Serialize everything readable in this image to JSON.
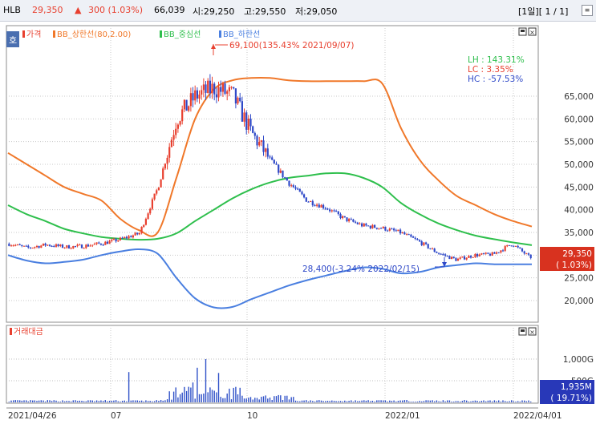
{
  "header": {
    "ticker": "HLB",
    "price": "29,350",
    "change_arrow": "▲",
    "change": "300 (1.03%)",
    "volume": "66,039",
    "open": "시:29,250",
    "high": "고:29,550",
    "low": "저:29,050",
    "period": "[1일][ 1 / 1]"
  },
  "colors": {
    "price_up": "#e8402f",
    "price_down": "#2f49c8",
    "bb_upper": "#f0782a",
    "bb_middle": "#2ebf4c",
    "bb_lower": "#4a7fe0",
    "volume": "#3052c8"
  },
  "price_panel": {
    "tab_label": "호",
    "legend": [
      {
        "label": "가격",
        "color": "#e8402f"
      },
      {
        "label": "BB_상한선(80,2.00)",
        "color": "#f0782a"
      },
      {
        "label": "BB_중심선",
        "color": "#2ebf4c"
      },
      {
        "label": "BB_하한선",
        "color": "#4a7fe0"
      }
    ],
    "high_annotation": "69,100(135.43% 2021/09/07)",
    "low_annotation": "28,400(-3.24% 2022/02/15)",
    "stats": {
      "lh": "LH :  143.31%",
      "lc": "LC :    3.35%",
      "hc": "HC :  -57.53%"
    },
    "current_price_box": "29,350",
    "current_change_box": "( 1.03%)",
    "y_ticks": [
      "65,000",
      "60,000",
      "55,000",
      "50,000",
      "45,000",
      "40,000",
      "35,000",
      "30,000",
      "25,000",
      "20,000"
    ]
  },
  "volume_panel": {
    "legend": "거래대금",
    "y_ticks": [
      "1,000G",
      "500G"
    ],
    "current_value_box": "1,935M",
    "current_pct_box": "( 19.71%)"
  },
  "x_axis": {
    "labels": [
      "2021/04/26",
      "07",
      "10",
      "2022/01",
      "2022/04/01"
    ]
  },
  "chart_data": {
    "type": "line",
    "title": "",
    "ylabel": "",
    "xlabel": "",
    "ylim": [
      15000,
      71000
    ],
    "x": [
      "2021/04/26",
      "2021/05/10",
      "2021/05/24",
      "2021/06/07",
      "2021/06/21",
      "2021/07/05",
      "2021/07/19",
      "2021/08/02",
      "2021/08/09",
      "2021/08/16",
      "2021/08/23",
      "2021/08/30",
      "2021/09/07",
      "2021/09/13",
      "2021/09/27",
      "2021/10/11",
      "2021/10/25",
      "2021/11/08",
      "2021/11/22",
      "2021/12/06",
      "2021/12/20",
      "2022/01/03",
      "2022/01/17",
      "2022/01/31",
      "2022/02/15",
      "2022/02/28",
      "2022/03/14",
      "2022/03/28",
      "2022/04/01"
    ],
    "series": [
      {
        "name": "가격",
        "values": [
          32500,
          31600,
          32300,
          31800,
          32000,
          32600,
          33500,
          34800,
          45000,
          60000,
          65000,
          66800,
          65200,
          57000,
          51000,
          46000,
          42000,
          40500,
          38000,
          36500,
          36000,
          35000,
          33000,
          30500,
          29000,
          30000,
          30200,
          32500,
          29350
        ]
      },
      {
        "name": "BB_상한선(80,2.00)",
        "values": [
          52500,
          50000,
          47500,
          45000,
          43500,
          42000,
          38000,
          35500,
          35000,
          47000,
          60000,
          66500,
          68500,
          69000,
          69000,
          68500,
          68300,
          68300,
          68300,
          68300,
          67800,
          58000,
          51000,
          46500,
          43000,
          41000,
          39000,
          37500,
          36300
        ]
      },
      {
        "name": "BB_중심선",
        "values": [
          41000,
          39000,
          37500,
          35800,
          34800,
          34000,
          33600,
          33400,
          33600,
          34800,
          37500,
          40000,
          42500,
          44500,
          46000,
          47000,
          47500,
          48000,
          48000,
          47000,
          45000,
          41500,
          39000,
          37000,
          35500,
          34300,
          33500,
          32800,
          32200
        ]
      },
      {
        "name": "BB_하한선",
        "values": [
          30000,
          28800,
          28200,
          28500,
          29000,
          30000,
          30800,
          31300,
          30300,
          25000,
          20500,
          18500,
          18600,
          20300,
          21800,
          23300,
          24500,
          25500,
          26500,
          27300,
          27000,
          26000,
          26300,
          27300,
          27800,
          28200,
          28000,
          28000,
          28000
        ]
      }
    ]
  }
}
